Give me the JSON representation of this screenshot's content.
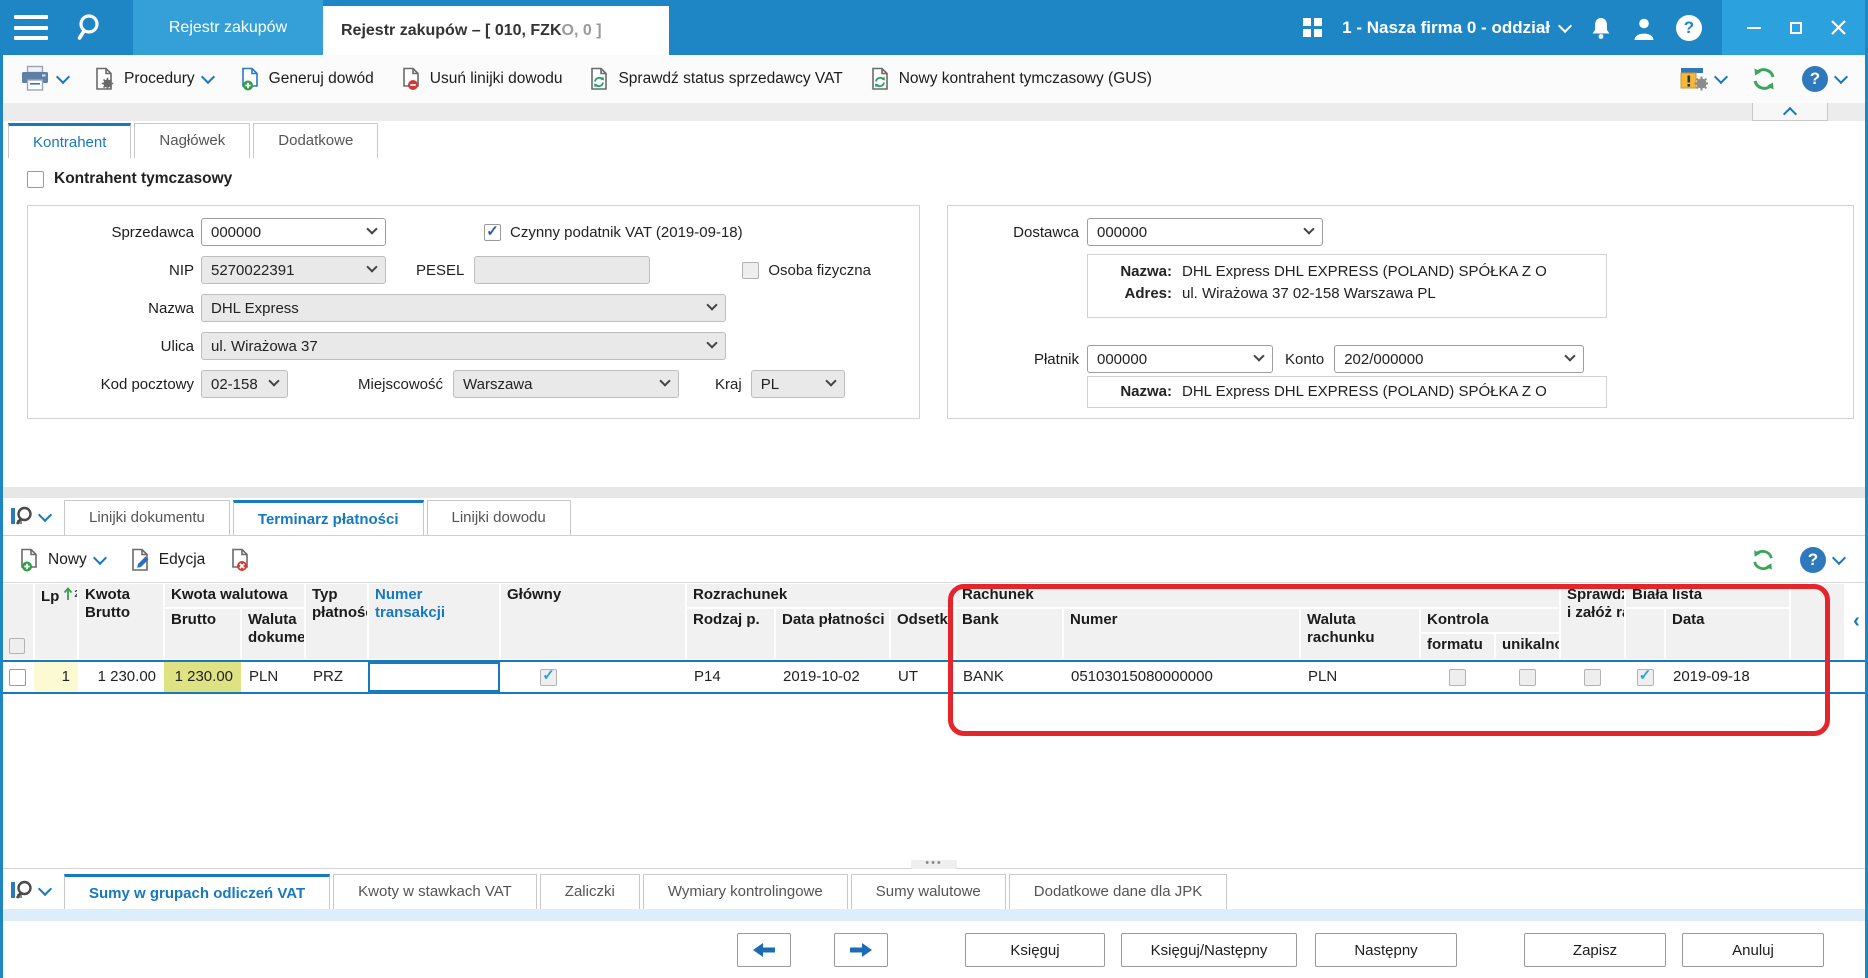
{
  "topbar": {
    "app_tab_label": "Rejestr zakupów",
    "doc_tab_label": "Rejestr zakupów – [ 010, FZK",
    "doc_tab_label_dim": "O, 0 ]",
    "company_selector": "1 - Nasza firma 0 - oddział"
  },
  "toolbar": {
    "procedury_label": "Procedury",
    "generuj_dowod_label": "Generuj dowód",
    "usun_linijki_label": "Usuń linijki dowodu",
    "sprawdz_vat_label": "Sprawdź status sprzedawcy VAT",
    "nowy_kontrahent_label": "Nowy kontrahent tymczasowy (GUS)"
  },
  "main_tabs": [
    "Kontrahent",
    "Nagłówek",
    "Dodatkowe"
  ],
  "form": {
    "kontrahent_tymczasowy_label": "Kontrahent tymczasowy",
    "sprzedawca_label": "Sprzedawca",
    "sprzedawca_value": "000000",
    "czynny_podatnik_label": "Czynny podatnik VAT (2019-09-18)",
    "czynny_podatnik_checked": true,
    "nip_label": "NIP",
    "nip_value": "5270022391",
    "pesel_label": "PESEL",
    "pesel_value": "",
    "osoba_fizyczna_label": "Osoba fizyczna",
    "osoba_fizyczna_checked": false,
    "nazwa_label": "Nazwa",
    "nazwa_value": "DHL Express",
    "ulica_label": "Ulica",
    "ulica_value": "ul. Wirażowa 37",
    "kod_pocztowy_label": "Kod pocztowy",
    "kod_pocztowy_value": "02-158",
    "miejscowosc_label": "Miejscowość",
    "miejscowosc_value": "Warszawa",
    "kraj_label": "Kraj",
    "kraj_value": "PL"
  },
  "supplier_panel": {
    "dostawca_label": "Dostawca",
    "dostawca_value": "000000",
    "nazwa_label": "Nazwa:",
    "nazwa_value": "DHL Express DHL EXPRESS (POLAND) SPÓŁKA Z O",
    "adres_label": "Adres:",
    "adres_value": "ul. Wirażowa 37 02-158 Warszawa PL",
    "platnik_label": "Płatnik",
    "platnik_value": "000000",
    "konto_label": "Konto",
    "konto_value": "202/000000",
    "platnik_nazwa_label": "Nazwa:",
    "platnik_nazwa_value": "DHL Express DHL EXPRESS (POLAND) SPÓŁKA Z O"
  },
  "grid_section": {
    "tabs": [
      "Linijki dokumentu",
      "Terminarz płatności",
      "Linijki dowodu"
    ],
    "active_tab": "Terminarz płatności",
    "nowy_label": "Nowy",
    "edycja_label": "Edycja"
  },
  "grid": {
    "headers": {
      "lp": "Lp",
      "lp_sort_order": "2",
      "kwota_line1": "Kwota",
      "kwota_line2": "Brutto",
      "group_kwota_walutowa": "Kwota walutowa",
      "kw_brutto": "Brutto",
      "waluta_line1": "Waluta",
      "waluta_line2": "dokumentu",
      "typ_line1": "Typ",
      "typ_line2": "płatności",
      "numer_line1": "Numer",
      "numer_line2": "transakcji",
      "glowny": "Główny",
      "group_rozrachunek": "Rozrachunek",
      "rodzaj": "Rodzaj p.",
      "data_platnosci": "Data płatności",
      "odsetki": "Odsetki",
      "group_rachunek": "Rachunek",
      "bank": "Bank",
      "numer_rachunku": "Numer",
      "waluta_rachunku_line1": "Waluta",
      "waluta_rachunku_line2": "rachunku",
      "group_kontrola": "Kontrola",
      "kontrola_formatu": "formatu",
      "kontrola_unikalnosci": "unikalności",
      "sprawdz_line1": "Sprawdź",
      "sprawdz_line2": "i załóż ra",
      "group_biala_lista": "Biała lista",
      "biala_lista_data": "Data"
    },
    "row": {
      "lp": "1",
      "kwota_brutto": "1 230.00",
      "kwota_walutowa_brutto": "1 230.00",
      "waluta_dokumentu": "PLN",
      "typ_platnosci": "PRZ",
      "numer_transakcji": "",
      "glowny_checked": true,
      "rodzaj": "P14",
      "data_platnosci": "2019-10-02",
      "odsetki": "UT",
      "bank": "BANK",
      "numer_rachunku": "05103015080000000",
      "waluta_rachunku": "PLN",
      "kontrola_formatu_checked": false,
      "kontrola_unikalnosci_checked": false,
      "sprawdz_checked": false,
      "biala_lista_checked": true,
      "biala_lista_data": "2019-09-18"
    }
  },
  "bottom_section": {
    "tabs": [
      "Sumy w grupach odliczeń VAT",
      "Kwoty w stawkach VAT",
      "Zaliczki",
      "Wymiary kontrolingowe",
      "Sumy walutowe",
      "Dodatkowe dane dla JPK"
    ],
    "active_tab": "Sumy w grupach odliczeń VAT"
  },
  "footer": {
    "ksieguj": "Księguj",
    "ksieguj_nastepny": "Księguj/Następny",
    "nastepny": "Następny",
    "zapisz": "Zapisz",
    "anuluj": "Anuluj"
  },
  "colors": {
    "topbar_blue": "#1F86C5",
    "accent_blue": "#1779BE",
    "annotation_red": "#E5252B",
    "row_highlight_yellow": "#FBFAD2",
    "row_highlight_yellow_green": "#DFE283",
    "check_blue": "#29A3E0"
  }
}
